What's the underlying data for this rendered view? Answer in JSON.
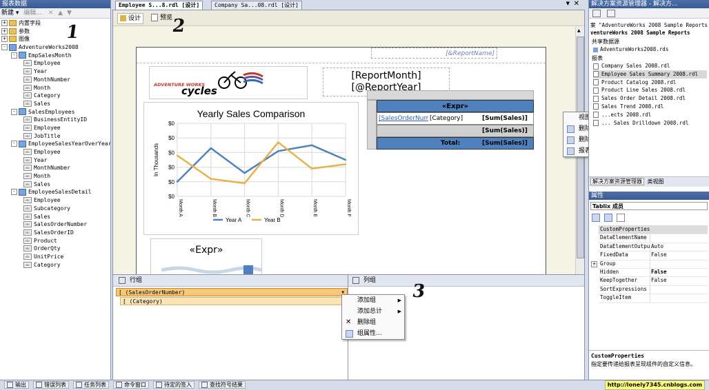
{
  "left_panel": {
    "title": "报表数据",
    "toolbar": {
      "new": "新建 ▾",
      "edit": "编辑..."
    },
    "tree": [
      {
        "label": "内置字段",
        "kind": "folder",
        "level": 0,
        "expander": "+"
      },
      {
        "label": "参数",
        "kind": "folder",
        "level": 0,
        "expander": "+"
      },
      {
        "label": "图像",
        "kind": "folder",
        "level": 0,
        "expander": "+"
      },
      {
        "label": "AdventureWorks2008",
        "kind": "source",
        "level": 0,
        "expander": "-"
      },
      {
        "label": "EmpSalesMonth",
        "kind": "dataset",
        "level": 1,
        "expander": "-"
      },
      {
        "label": "Employee",
        "kind": "field",
        "level": 2
      },
      {
        "label": "Year",
        "kind": "field",
        "level": 2
      },
      {
        "label": "MonthNumber",
        "kind": "field",
        "level": 2
      },
      {
        "label": "Month",
        "kind": "field",
        "level": 2
      },
      {
        "label": "Category",
        "kind": "field",
        "level": 2
      },
      {
        "label": "Sales",
        "kind": "field",
        "level": 2
      },
      {
        "label": "SalesEmployees",
        "kind": "dataset",
        "level": 1,
        "expander": "-"
      },
      {
        "label": "BusinessEntityID",
        "kind": "field",
        "level": 2
      },
      {
        "label": "Employee",
        "kind": "field",
        "level": 2
      },
      {
        "label": "JobTitle",
        "kind": "field",
        "level": 2
      },
      {
        "label": "EmployeeSalesYearOverYear",
        "kind": "dataset",
        "level": 1,
        "expander": "-"
      },
      {
        "label": "Employee",
        "kind": "field",
        "level": 2
      },
      {
        "label": "Year",
        "kind": "field",
        "level": 2
      },
      {
        "label": "MonthNumber",
        "kind": "field",
        "level": 2
      },
      {
        "label": "Month",
        "kind": "field",
        "level": 2
      },
      {
        "label": "Sales",
        "kind": "field",
        "level": 2
      },
      {
        "label": "EmployeeSalesDetail",
        "kind": "dataset",
        "level": 1,
        "expander": "-"
      },
      {
        "label": "Employee",
        "kind": "field",
        "level": 2
      },
      {
        "label": "Subcategory",
        "kind": "field",
        "level": 2
      },
      {
        "label": "Sales",
        "kind": "field",
        "level": 2
      },
      {
        "label": "SalesOrderNumber",
        "kind": "field",
        "level": 2
      },
      {
        "label": "SalesOrderID",
        "kind": "field",
        "level": 2
      },
      {
        "label": "Product",
        "kind": "field",
        "level": 2
      },
      {
        "label": "OrderQty",
        "kind": "field",
        "level": 2
      },
      {
        "label": "UnitPrice",
        "kind": "field",
        "level": 2
      },
      {
        "label": "Category",
        "kind": "field",
        "level": 2
      }
    ]
  },
  "doc_tabs": {
    "active": "Employee S...8.rdl [设计]",
    "inactive": "Company Sa...08.rdl [设计]"
  },
  "view_tabs": {
    "design": "设计",
    "preview": "预览"
  },
  "report": {
    "report_name": "[&ReportName]",
    "logo_line1": "ADVENTURE WORKS",
    "logo_line2": "cycles",
    "header_line1": "[ReportMonth]",
    "header_line2": "[@ReportYear]",
    "tablix": {
      "expr_header": "«Expr»",
      "row1": [
        "[SalesOrderNum",
        "[Category]",
        "[Sum(Sales)]"
      ],
      "row2_value": "[Sum(Sales)]",
      "total_label": "Total:",
      "total_value": "[Sum(Sales)]"
    },
    "chart2_title": "«Expr»"
  },
  "chart_data": {
    "type": "line",
    "title": "Yearly Sales Comparison",
    "ylabel": "In Thousands",
    "y_ticks": [
      "$0",
      "$0",
      "$0",
      "$0",
      "$0",
      "$0"
    ],
    "categories": [
      "Month A",
      "Month B",
      "Month C",
      "Month D",
      "Month E",
      "Month F"
    ],
    "series": [
      {
        "name": "Year A",
        "color": "#4e81bd",
        "values": [
          1.0,
          3.3,
          1.6,
          3.1,
          3.5,
          2.5
        ]
      },
      {
        "name": "Year B",
        "color": "#e9b04a",
        "values": [
          2.8,
          1.2,
          0.9,
          3.7,
          1.9,
          2.2
        ]
      }
    ],
    "ylim": [
      0,
      5
    ]
  },
  "context_menu_design": {
    "items": [
      {
        "label": "视图",
        "submenu": true,
        "icon": ""
      },
      {
        "label": "删除页眉",
        "submenu": false,
        "icon": "page-header-icon"
      },
      {
        "label": "删除页脚",
        "submenu": false,
        "icon": "page-footer-icon"
      },
      {
        "label": "报表属性...",
        "submenu": false,
        "icon": "report-properties-icon"
      }
    ]
  },
  "grouping": {
    "row_groups_title": "行组",
    "column_groups_title": "列组",
    "row_groups": [
      "[ (SalesOrderNumber)",
      "[ (Category)"
    ]
  },
  "context_menu_group": {
    "items": [
      {
        "label": "添加组",
        "submenu": true,
        "icon": ""
      },
      {
        "label": "添加总计",
        "submenu": true,
        "icon": ""
      },
      {
        "label": "删除组",
        "submenu": false,
        "icon": "delete-icon"
      },
      {
        "label": "组属性...",
        "submenu": false,
        "icon": "group-properties-icon"
      }
    ]
  },
  "solution_explorer": {
    "title": "解决方案资源管理器 - 解决方...",
    "solution_line": "案 \"AdventureWorks 2008 Sample Reports",
    "project": "ventureWorks 2008 Sample Reports",
    "shared_ds_folder": "共享数据源",
    "shared_ds": "AdventureWorks2008.rds",
    "reports_folder": "报表",
    "reports": [
      "Company Sales 2008.rdl",
      "Employee Sales Summary 2008.rdl",
      "Product Catalog 2008.rdl",
      "Product Line Sales 2008.rdl",
      "Sales Order Detail 2008.rdl",
      "Sales Trend 2008.rdl",
      "...ects 2008.rdl",
      "... Sales Drilldown 2008.rdl"
    ],
    "selected_index": 1,
    "bottom_tabs": [
      "解决方案资源管理器",
      "类视图"
    ]
  },
  "properties": {
    "title": "属性",
    "object": "Tablix 成员",
    "rows": [
      {
        "key": "CustomProperties",
        "value": "",
        "expander": ""
      },
      {
        "key": "DataElementName",
        "value": "",
        "expander": ""
      },
      {
        "key": "DataElementOutpu",
        "value": "Auto",
        "expander": ""
      },
      {
        "key": "FixedData",
        "value": "False",
        "expander": ""
      },
      {
        "key": "Group",
        "value": "",
        "expander": "+"
      },
      {
        "key": "Hidden",
        "value": "False",
        "expander": ""
      },
      {
        "key": "KeepTogether",
        "value": "False",
        "expander": ""
      },
      {
        "key": "SortExpressions",
        "value": "",
        "expander": ""
      },
      {
        "key": "ToggleItem",
        "value": "",
        "expander": ""
      }
    ],
    "desc_title": "CustomProperties",
    "desc_text": "指定要传递给报表呈现组件的自定义信息。"
  },
  "status_bar": {
    "items": [
      "输出",
      "错误列表",
      "任务列表",
      "命令窗口",
      "待定的签入",
      "查找符号结果"
    ],
    "watermark": "http://lonely7345.cnblogs.com"
  },
  "annotations": [
    "1",
    "2",
    "3"
  ]
}
